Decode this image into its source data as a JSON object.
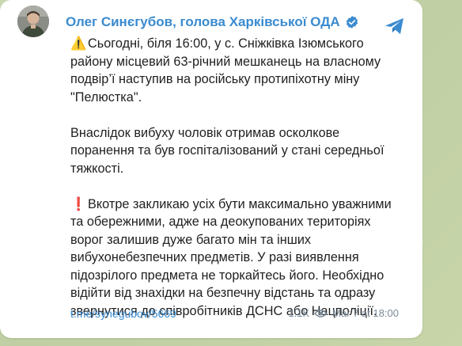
{
  "channel": {
    "name": "Олег Синєгубов, голова Харківської ОДА",
    "verified_icon": "verified-badge-icon",
    "share_icon": "telegram-plane-icon"
  },
  "post": {
    "paragraphs": [
      {
        "emoji": "⚠️",
        "text": "Сьогодні, біля 16:00, у с. Сніжківка Ізюмського району місцевий 63-річний мешканець на власному подвір’ї наступив на російську протипіхотну міну \"Пелюстка\"."
      },
      {
        "emoji": "",
        "text": "Внаслідок вибуху чоловік отримав осколкове поранення та був госпіталізований у стані середньої тяжкості."
      },
      {
        "emoji": "❗",
        "text": "Вкотре закликаю усіх бути максимально уважними та обережними, адже на деокупованих територіях ворог залишив дуже багато мін та інших вибухонебезпечних предметів. У разі виявлення підозрілого предмета не торкайтесь його. Необхідно відійти від знахідки на безпечну відстань та одразу звернутися до співробітників ДСНС або Нацполіції."
      }
    ],
    "link": "t.me/synegubov/5669",
    "views": "1.1K",
    "date": "Mar 7 at 18:00"
  },
  "colors": {
    "accent": "#3a8bd0",
    "background": "#c9d7b3",
    "text": "#1f1f1f",
    "meta": "#7a8a99"
  }
}
